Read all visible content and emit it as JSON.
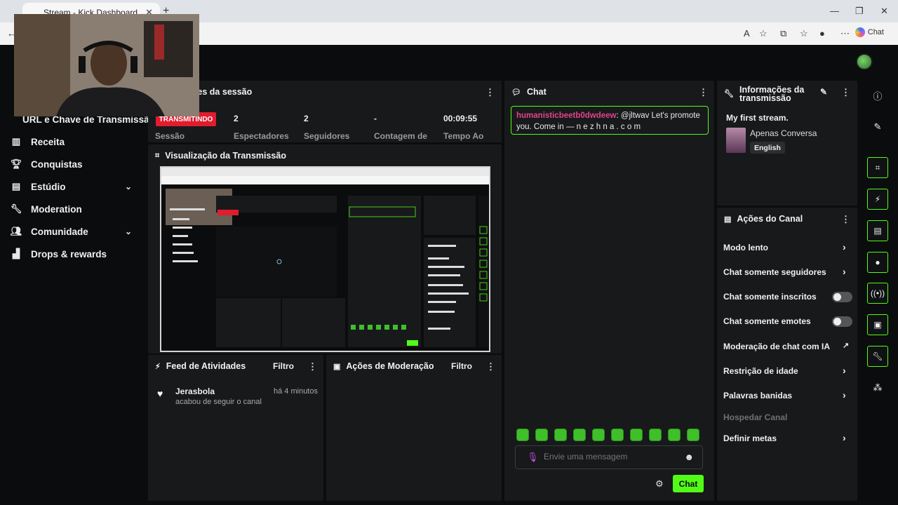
{
  "browser": {
    "tab_title": "Stream - Kick Dashboard",
    "chat_label": "Chat"
  },
  "sidebar": {
    "items": [
      {
        "label": "URL e Chave de Transmissão"
      },
      {
        "label": "Receita",
        "icon": "bar-chart-icon"
      },
      {
        "label": "Conquistas",
        "icon": "trophy-icon"
      },
      {
        "label": "Estúdio",
        "icon": "studio-icon"
      },
      {
        "label": "Moderation",
        "icon": "wrench-icon"
      },
      {
        "label": "Comunidade",
        "icon": "people-icon"
      },
      {
        "label": "Drops & rewards",
        "icon": "drops-icon"
      }
    ]
  },
  "session": {
    "title": "Informações da sessão",
    "status_badge": "TRANSMITINDO",
    "stats": [
      {
        "value": "",
        "label": "Sessão"
      },
      {
        "value": "2",
        "label": "Espectadores"
      },
      {
        "value": "2",
        "label": "Seguidores"
      },
      {
        "value": "-",
        "label": "Contagem de"
      },
      {
        "value": "00:09:55",
        "label": "Tempo Ao"
      }
    ]
  },
  "preview": {
    "title": "Visualização da Transmissão"
  },
  "activity": {
    "title": "Feed de Atividades",
    "filter": "Filtro",
    "items": [
      {
        "name": "Jerasbola",
        "desc": "acabou de seguir o canal",
        "time": "há 4 minutos"
      }
    ]
  },
  "moderation_actions": {
    "title": "Ações de Moderação",
    "filter": "Filtro"
  },
  "chat": {
    "title": "Chat",
    "message_user": "humanisticbeetb0dwdeew",
    "message_text": ": @jltwav Let's promote you. Come  in  — n e z h n a . c o m",
    "input_placeholder": "Envie uma mensagem",
    "send_label": "Chat",
    "emote_count": 10
  },
  "stream_info": {
    "title": "Informações da transmissão",
    "stream_title": "My first stream.",
    "category": "Apenas Conversa",
    "tag": "English"
  },
  "channel_actions": {
    "title": "Ações do Canal",
    "items": [
      {
        "label": "Modo lento",
        "control": "chevron"
      },
      {
        "label": "Chat somente seguidores",
        "control": "chevron"
      },
      {
        "label": "Chat somente inscritos",
        "control": "toggle"
      },
      {
        "label": "Chat somente emotes",
        "control": "toggle"
      },
      {
        "label": "Moderação de chat com IA",
        "control": "external"
      },
      {
        "label": "Restrição de idade",
        "control": "chevron"
      },
      {
        "label": "Palavras banidas",
        "control": "chevron"
      },
      {
        "label": "Hospedar Canal",
        "control": "none"
      },
      {
        "label": "Definir metas",
        "control": "chevron"
      }
    ]
  },
  "colors": {
    "accent": "#53fc18",
    "live": "#e01c2e",
    "panel": "#18191b",
    "background": "#0b0c0d"
  }
}
